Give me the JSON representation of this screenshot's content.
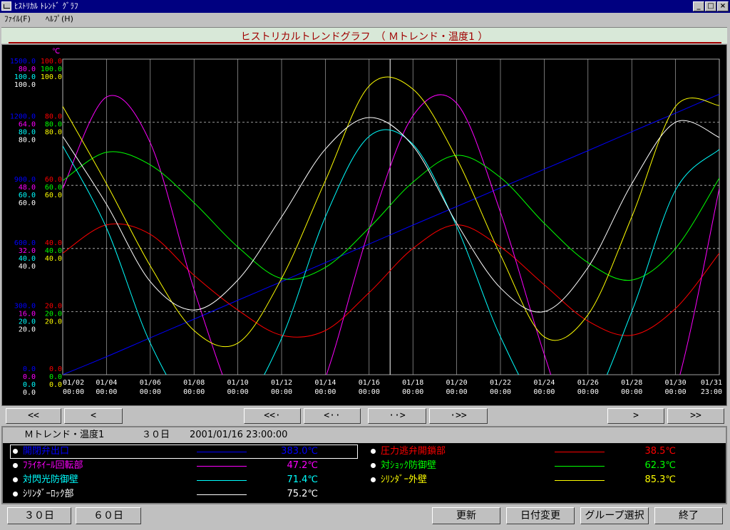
{
  "window": {
    "title": "ﾋｽﾄﾘｶﾙ ﾄﾚﾝﾄﾞ ｸﾞﾗﾌ",
    "minimize": "_",
    "maximize": "□",
    "close": "×"
  },
  "menu": {
    "file": "ﾌｧｲﾙ(F)",
    "help": "ﾍﾙﾌﾟ(H)"
  },
  "header": {
    "title": "ヒストリカルトレンドグラフ　（ Ｍトレンド・温度1 ）"
  },
  "nav": {
    "first": "<<",
    "prev": "<",
    "back_page": "<<·",
    "back_half": "<··",
    "fwd_half": "··>",
    "fwd_page": "·>>",
    "next": ">",
    "last": ">>"
  },
  "info": {
    "group": "Ｍトレンド・温度1",
    "period": "３０日",
    "datetime": "2001/01/16 23:00:00"
  },
  "legend": [
    {
      "name": "開閉弁出口",
      "value": "383.0℃",
      "color": "#0000ff"
    },
    {
      "name": "圧力逃弁開鎖部",
      "value": "38.5℃",
      "color": "#ff0000"
    },
    {
      "name": "ﾌﾗｲﾎｲｰﾙ回転部",
      "value": "47.2℃",
      "color": "#ff00ff"
    },
    {
      "name": "対ｼｮｯｸ防御壁",
      "value": "62.3℃",
      "color": "#00ff00"
    },
    {
      "name": "対閃光防御壁",
      "value": "71.4℃",
      "color": "#00ffff"
    },
    {
      "name": "ｼﾘﾝﾀﾞｰ外壁",
      "value": "85.3℃",
      "color": "#ffff00"
    },
    {
      "name": "ｼﾘﾝﾀﾞｰﾛｯｸ部",
      "value": "75.2℃",
      "color": "#ffffff"
    }
  ],
  "buttons": {
    "days30": "３０日",
    "days60": "６０日",
    "update": "更新",
    "date_change": "日付変更",
    "group_select": "グループ選択",
    "exit": "終了"
  },
  "chart_data": {
    "type": "line",
    "unit_label": "℃",
    "x": [
      "01/02 00:00",
      "01/04 00:00",
      "01/06 00:00",
      "01/08 00:00",
      "01/10 00:00",
      "01/12 00:00",
      "01/14 00:00",
      "01/16 00:00",
      "01/18 00:00",
      "01/20 00:00",
      "01/22 00:00",
      "01/24 00:00",
      "01/26 00:00",
      "01/28 00:00",
      "01/30 00:00",
      "01/31 23:00"
    ],
    "x_ticks": [
      {
        "date": "01/02",
        "time": "00:00"
      },
      {
        "date": "01/04",
        "time": "00:00"
      },
      {
        "date": "01/06",
        "time": "00:00"
      },
      {
        "date": "01/08",
        "time": "00:00"
      },
      {
        "date": "01/10",
        "time": "00:00"
      },
      {
        "date": "01/12",
        "time": "00:00"
      },
      {
        "date": "01/14",
        "time": "00:00"
      },
      {
        "date": "01/16",
        "time": "00:00"
      },
      {
        "date": "01/18",
        "time": "00:00"
      },
      {
        "date": "01/20",
        "time": "00:00"
      },
      {
        "date": "01/22",
        "time": "00:00"
      },
      {
        "date": "01/24",
        "time": "00:00"
      },
      {
        "date": "01/26",
        "time": "00:00"
      },
      {
        "date": "01/28",
        "time": "00:00"
      },
      {
        "date": "01/30",
        "time": "00:00"
      },
      {
        "date": "01/31",
        "time": "23:00"
      }
    ],
    "y_ticks": [
      {
        "level": 0,
        "labels": [
          [
            "0.0",
            "#0000ff"
          ],
          [
            "0.0",
            "#ff00ff"
          ],
          [
            "0.0",
            "#00ffff"
          ],
          [
            "0.0",
            "#ffffff"
          ]
        ],
        "labels2": [
          [
            "0.0",
            "#ff0000"
          ],
          [
            "0.0",
            "#00ff00"
          ],
          [
            "0.0",
            "#ffff00"
          ]
        ]
      },
      {
        "level": 20,
        "labels": [
          [
            "300.0",
            "#0000ff"
          ],
          [
            "16.0",
            "#ff00ff"
          ],
          [
            "20.0",
            "#00ffff"
          ],
          [
            "20.0",
            "#ffffff"
          ]
        ],
        "labels2": [
          [
            "20.0",
            "#ff0000"
          ],
          [
            "20.0",
            "#00ff00"
          ],
          [
            "20.0",
            "#ffff00"
          ]
        ]
      },
      {
        "level": 40,
        "labels": [
          [
            "600.0",
            "#0000ff"
          ],
          [
            "32.0",
            "#ff00ff"
          ],
          [
            "40.0",
            "#00ffff"
          ],
          [
            "40.0",
            "#ffffff"
          ]
        ],
        "labels2": [
          [
            "40.0",
            "#ff0000"
          ],
          [
            "40.0",
            "#00ff00"
          ],
          [
            "40.0",
            "#ffff00"
          ]
        ]
      },
      {
        "level": 60,
        "labels": [
          [
            "900.0",
            "#0000ff"
          ],
          [
            "48.0",
            "#ff00ff"
          ],
          [
            "60.0",
            "#00ffff"
          ],
          [
            "60.0",
            "#ffffff"
          ]
        ],
        "labels2": [
          [
            "60.0",
            "#ff0000"
          ],
          [
            "60.0",
            "#00ff00"
          ],
          [
            "60.0",
            "#ffff00"
          ]
        ]
      },
      {
        "level": 80,
        "labels": [
          [
            "1200.0",
            "#0000ff"
          ],
          [
            "64.0",
            "#ff00ff"
          ],
          [
            "80.0",
            "#00ffff"
          ],
          [
            "80.0",
            "#ffffff"
          ]
        ],
        "labels2": [
          [
            "80.0",
            "#ff0000"
          ],
          [
            "80.0",
            "#00ff00"
          ],
          [
            "80.0",
            "#ffff00"
          ]
        ]
      },
      {
        "level": 100,
        "labels": [
          [
            "1500.0",
            "#0000ff"
          ],
          [
            "80.0",
            "#ff00ff"
          ],
          [
            "100.0",
            "#00ffff"
          ],
          [
            "100.0",
            "#ffffff"
          ]
        ],
        "labels2": [
          [
            "100.0",
            "#ff0000"
          ],
          [
            "100.0",
            "#00ff00"
          ],
          [
            "100.0",
            "#ffff00"
          ]
        ]
      }
    ],
    "ylim": [
      0,
      100
    ],
    "grid": true,
    "cursor_x": "01/16 23:00",
    "series": [
      {
        "name": "開閉弁出口",
        "color": "#0000ff",
        "values": [
          0.0,
          5.7,
          11.7,
          17.6,
          23.6,
          29.5,
          35.5,
          41.4,
          47.4,
          53.3,
          59.2,
          65.1,
          71.0,
          77.0,
          82.9,
          88.9
        ]
      },
      {
        "name": "圧力逃弁開鎖部",
        "color": "#ff0000",
        "values": [
          38.5,
          47.5,
          44.5,
          31.5,
          20.5,
          12.5,
          14.0,
          26.0,
          40.0,
          47.5,
          40.5,
          28.5,
          17.0,
          12.5,
          21.0,
          38.5
        ]
      },
      {
        "name": "ﾌﾗｲﾎｲｰﾙ回転部",
        "color": "#ff00ff",
        "values": [
          59.0,
          88.0,
          73.5,
          27.0,
          -12.0,
          -32.0,
          -1.0,
          46.0,
          82.0,
          86.0,
          51.5,
          6.5,
          -32.0,
          -31.0,
          -5.0,
          59.0
        ]
      },
      {
        "name": "対ｼｮｯｸ防御壁",
        "color": "#00ff00",
        "values": [
          61.5,
          70.5,
          66.5,
          54.5,
          40.5,
          30.5,
          34.0,
          46.5,
          61.0,
          69.5,
          62.5,
          48.0,
          35.5,
          30.0,
          40.0,
          62.3
        ]
      },
      {
        "name": "対閃光防御壁",
        "color": "#00ffff",
        "values": [
          72.5,
          46.5,
          10.0,
          -12.0,
          -12.0,
          11.5,
          50.0,
          75.5,
          73.0,
          47.0,
          12.0,
          -12.0,
          -11.0,
          20.0,
          58.5,
          71.4
        ]
      },
      {
        "name": "ｼﾘﾝﾀﾞｰ外壁",
        "color": "#ffff00",
        "values": [
          85.0,
          60.5,
          34.5,
          14.0,
          10.0,
          30.5,
          61.5,
          91.5,
          90.5,
          68.5,
          38.0,
          12.0,
          19.0,
          50.0,
          85.0,
          85.3
        ]
      },
      {
        "name": "ｼﾘﾝﾀﾞｰﾛｯｸ部",
        "color": "#ffffff",
        "values": [
          75.5,
          54.0,
          29.5,
          20.5,
          30.0,
          50.0,
          71.5,
          81.5,
          72.5,
          48.0,
          27.5,
          20.0,
          34.0,
          60.5,
          80.0,
          75.2
        ]
      }
    ]
  }
}
